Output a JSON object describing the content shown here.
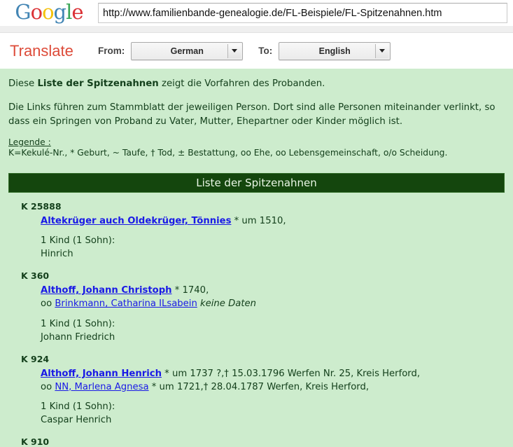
{
  "browser": {
    "logo_letters": [
      {
        "char": "G",
        "color": "#4285b4"
      },
      {
        "char": "o",
        "color": "#db3236"
      },
      {
        "char": "o",
        "color": "#f4c20d"
      },
      {
        "char": "g",
        "color": "#4285b4"
      },
      {
        "char": "l",
        "color": "#3aa757"
      },
      {
        "char": "e",
        "color": "#db3236"
      }
    ],
    "url": "http://www.familienbande-genealogie.de/FL-Beispiele/FL-Spitzenahnen.htm"
  },
  "toolbar": {
    "translate_label": "Translate",
    "from_label": "From:",
    "from_value": "German",
    "to_label": "To:",
    "to_value": "English"
  },
  "content": {
    "intro_1_prefix": "Diese ",
    "intro_1_bold": "Liste der Spitzenahnen",
    "intro_1_suffix": " zeigt die Vorfahren des Probanden.",
    "intro_2": "Die Links führen zum Stammblatt der jeweiligen Person. Dort sind alle Personen miteinander verlinkt, so dass ein Springen von Proband zu Vater, Mutter, Ehepartner oder Kinder möglich ist.",
    "legend_title": "Legende :",
    "legend_line": "K=Kekulé-Nr., * Geburt, ~ Taufe, † Tod, ± Bestattung, oo Ehe, oo Lebensgemeinschaft, o/o Scheidung.",
    "section_title": "Liste der Spitzenahnen",
    "entries": [
      {
        "knum": "K 25888",
        "person_link": "Altekrüger auch Oldekrüger, Tönnies",
        "person_dates": " * um 1510,",
        "spouse_prefix": "",
        "spouse_link": "",
        "spouse_dates": "",
        "children_count": "1 Kind (1 Sohn):",
        "children_names": "Hinrich"
      },
      {
        "knum": "K 360",
        "person_link": "Althoff, Johann Christoph",
        "person_dates": " * 1740,",
        "spouse_prefix": "oo ",
        "spouse_link": "Brinkmann, Catharina ILsabein",
        "spouse_dates": " keine Daten",
        "spouse_dates_italic": true,
        "children_count": "1 Kind (1 Sohn):",
        "children_names": "Johann Friedrich"
      },
      {
        "knum": "K 924",
        "person_link": "Althoff, Johann Henrich",
        "person_dates": " * um 1737 ?,† 15.03.1796 Werfen Nr. 25, Kreis Herford,",
        "spouse_prefix": "oo ",
        "spouse_link": "NN, Marlena Agnesa",
        "spouse_dates": " * um 1721,† 28.04.1787 Werfen, Kreis Herford,",
        "spouse_dates_italic": false,
        "children_count": "1 Kind (1 Sohn):",
        "children_names": "Caspar Henrich"
      },
      {
        "knum": "K 910",
        "person_link": "",
        "person_dates": "",
        "spouse_prefix": "",
        "spouse_link": "",
        "spouse_dates": "",
        "children_count": "",
        "children_names": ""
      }
    ]
  }
}
